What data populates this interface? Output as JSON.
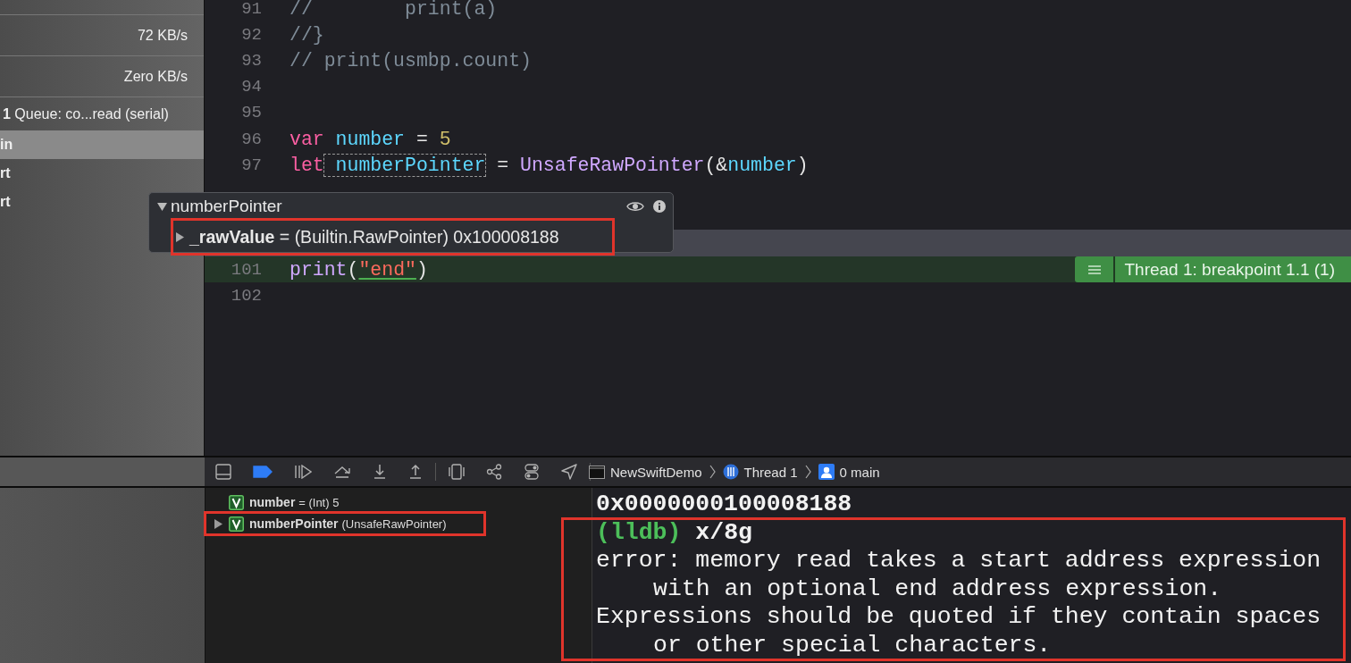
{
  "sidebar": {
    "rows": [
      {
        "kind": "rate",
        "text": "72 KB/s",
        "selected": false
      },
      {
        "kind": "rate",
        "text": "Zero KB/s",
        "selected": false
      },
      {
        "kind": "queue",
        "number": "1",
        "text": "Queue: co...read (serial)",
        "selected": false
      },
      {
        "kind": "frame",
        "text": "in",
        "selected": true
      },
      {
        "kind": "frame",
        "text": "rt",
        "selected": false
      },
      {
        "kind": "frame",
        "text": "rt",
        "selected": false
      }
    ]
  },
  "editor": {
    "lines_before": [
      {
        "number": "91",
        "tokens": [
          {
            "kind": "comment",
            "text": "//        print(a)"
          }
        ]
      },
      {
        "number": "92",
        "tokens": [
          {
            "kind": "comment",
            "text": "//}"
          }
        ]
      },
      {
        "number": "93",
        "tokens": [
          {
            "kind": "comment",
            "text": "// print(usmbp.count)"
          }
        ]
      },
      {
        "number": "94"
      },
      {
        "number": "95"
      },
      {
        "number": "96",
        "tokens": [
          {
            "kind": "keyword",
            "text": "var"
          },
          {
            "kind": "variable",
            "text": "number",
            "space_before": true
          },
          {
            "kind": "plain",
            "text": "=",
            "space_before": true
          },
          {
            "kind": "number",
            "text": "5",
            "space_before": true
          }
        ]
      },
      {
        "number": "97",
        "tokens": [
          {
            "kind": "keyword",
            "text": "let"
          },
          {
            "kind": "variable",
            "text": "numberPointer",
            "hovered": true,
            "space_before": true
          },
          {
            "kind": "plain",
            "text": "=",
            "space_before": true
          },
          {
            "kind": "type",
            "text": "UnsafeRawPointer",
            "space_before": true
          },
          {
            "kind": "plain",
            "text": "(&"
          },
          {
            "kind": "variable",
            "text": "number"
          },
          {
            "kind": "plain",
            "text": ")"
          }
        ]
      }
    ],
    "popover": {
      "title": "numberPointer",
      "expanded": true,
      "child": {
        "name": "_rawValue",
        "value": "= (Builtin.RawPointer) 0x100008188",
        "expanded": false,
        "highlighted": true
      }
    },
    "lines_after": [
      {
        "number": "101",
        "current": true,
        "breakpoint_label": "Thread 1: breakpoint 1.1 (1)",
        "tokens": [
          {
            "kind": "function",
            "text": "print"
          },
          {
            "kind": "plain",
            "text": "("
          },
          {
            "kind": "string",
            "text": "\"end\""
          },
          {
            "kind": "plain",
            "text": ")"
          }
        ]
      },
      {
        "number": "102",
        "current": false
      }
    ]
  },
  "toolbar": {
    "breakpoints_active": true,
    "breadcrumbs": [
      {
        "kind": "app",
        "label": "NewSwiftDemo"
      },
      {
        "kind": "thread",
        "label": "Thread 1"
      },
      {
        "kind": "frame",
        "label": "0 main"
      }
    ]
  },
  "variables": [
    {
      "name": "number",
      "type_text": "= (Int) 5",
      "expandable": false,
      "highlighted": false
    },
    {
      "name": "numberPointer",
      "type_text": "(UnsafeRawPointer)",
      "expandable": true,
      "highlighted": true
    }
  ],
  "console": {
    "groups": [
      {
        "highlighted": false,
        "lines": [
          {
            "kind": "output",
            "text": "0x0000000100008188"
          }
        ]
      },
      {
        "highlighted": true,
        "lines": [
          {
            "kind": "prompt",
            "prompt": "(lldb)",
            "text": "x/8g"
          },
          {
            "kind": "plain",
            "text": "error: memory read takes a start address expression"
          },
          {
            "kind": "wrapped",
            "text": "with an optional end address expression."
          },
          {
            "kind": "plain",
            "text": "Expressions should be quoted if they contain spaces"
          },
          {
            "kind": "wrapped",
            "text": "or other special characters."
          }
        ]
      }
    ]
  }
}
